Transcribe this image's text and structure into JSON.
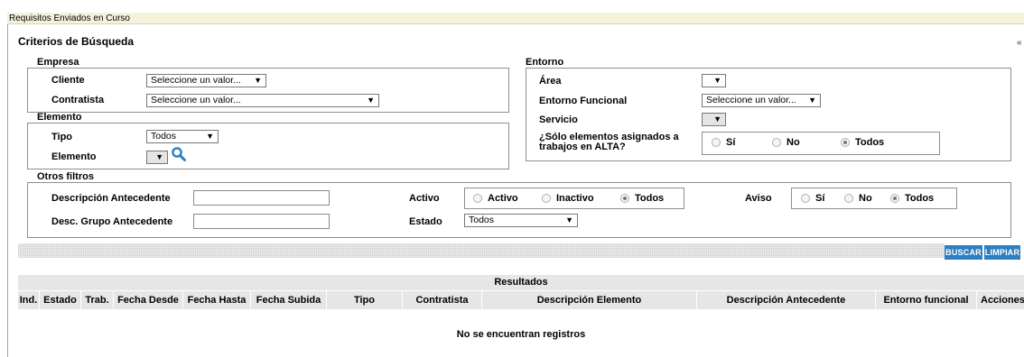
{
  "window": {
    "title": "Requisitos Enviados en Curso"
  },
  "criteria": {
    "title": "Criterios de Búsqueda",
    "collapse_glyph": "«"
  },
  "empresa": {
    "legend": "Empresa",
    "cliente_label": "Cliente",
    "cliente_value": "Seleccione un valor...",
    "contratista_label": "Contratista",
    "contratista_value": "Seleccione un valor..."
  },
  "elemento": {
    "legend": "Elemento",
    "tipo_label": "Tipo",
    "tipo_value": "Todos",
    "elemento_label": "Elemento",
    "elemento_value": "",
    "search_icon": "magnifier-icon"
  },
  "entorno": {
    "legend": "Entorno",
    "area_label": "Área",
    "area_value": "",
    "funcional_label": "Entorno Funcional",
    "funcional_value": "Seleccione un valor...",
    "servicio_label": "Servicio",
    "servicio_value": "",
    "alta_label_line1": "¿Sólo elementos asignados a",
    "alta_label_line2": "trabajos en ALTA?",
    "alta_options": [
      "Sí",
      "No",
      "Todos"
    ],
    "alta_selected": "Todos"
  },
  "otros": {
    "legend": "Otros filtros",
    "desc_antecedente_label": "Descripción Antecedente",
    "desc_antecedente_value": "",
    "desc_grupo_label": "Desc. Grupo Antecedente",
    "desc_grupo_value": "",
    "activo_label": "Activo",
    "activo_options": [
      "Activo",
      "Inactivo",
      "Todos"
    ],
    "activo_selected": "Todos",
    "estado_label": "Estado",
    "estado_value": "Todos",
    "aviso_label": "Aviso",
    "aviso_options": [
      "Sí",
      "No",
      "Todos"
    ],
    "aviso_selected": "Todos"
  },
  "buttons": {
    "buscar": "BUSCAR",
    "limpiar": "LIMPIAR"
  },
  "results": {
    "title": "Resultados",
    "columns": [
      "Ind.",
      "Estado",
      "Trab.",
      "Fecha Desde",
      "Fecha Hasta",
      "Fecha Subida",
      "Tipo",
      "Contratista",
      "Descripción Elemento",
      "Descripción Antecedente",
      "Entorno funcional",
      "Acciones"
    ],
    "empty_message": "No se encuentran registros"
  },
  "colors": {
    "accent_button": "#2d7fc1",
    "title_bar": "#f5f2dc",
    "header_bg": "#e6e6e6"
  }
}
